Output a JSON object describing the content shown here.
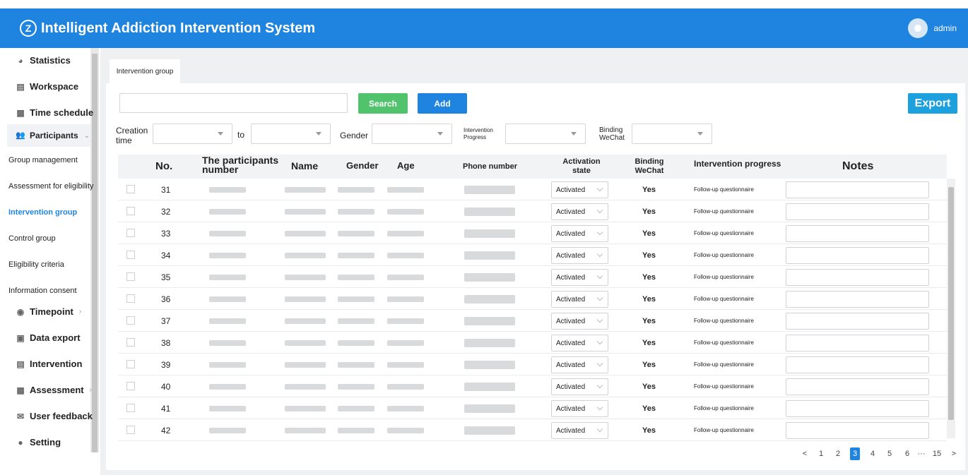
{
  "app": {
    "title": "Intelligent Addiction Intervention System",
    "user": "admin"
  },
  "sidebar": {
    "items": [
      {
        "label": "Statistics",
        "icon": "pie-chart-icon",
        "glyph": "◕"
      },
      {
        "label": "Workspace",
        "icon": "workspace-icon",
        "glyph": "▤"
      },
      {
        "label": "Time schedule",
        "icon": "calendar-icon",
        "glyph": "▦"
      },
      {
        "label": "Participants",
        "icon": "people-icon",
        "glyph": "👥"
      },
      {
        "label": "Timepoint",
        "icon": "timepoint-icon",
        "glyph": "◉"
      },
      {
        "label": "Data export",
        "icon": "export-folder-icon",
        "glyph": "▣"
      },
      {
        "label": "Intervention",
        "icon": "document-icon",
        "glyph": "▤"
      },
      {
        "label": "Assessment",
        "icon": "assessment-icon",
        "glyph": "▦"
      },
      {
        "label": "User feedback",
        "icon": "feedback-icon",
        "glyph": "✉"
      },
      {
        "label": "Setting",
        "icon": "setting-icon",
        "glyph": "●"
      }
    ],
    "subitems": [
      "Group management",
      "Assessment for eligibility",
      "Intervention group",
      "Control group",
      "Eligibility criteria",
      "Information consent"
    ],
    "active_subitem": "Intervention group"
  },
  "tab": {
    "label": "Intervention group"
  },
  "toolbar": {
    "search": "Search",
    "add": "Add",
    "export": "Export",
    "search_value": ""
  },
  "filters": {
    "creation_time_label": "Creation time",
    "to_label": "to",
    "gender_label": "Gender",
    "progress_label": "Intervention Progress",
    "wechat_label": "Binding WeChat"
  },
  "table": {
    "headers": {
      "no": "No.",
      "pnum": "The participants number",
      "name": "Name",
      "gender": "Gender",
      "age": "Age",
      "phone": "Phone number",
      "activation": "Activation state",
      "wechat": "Binding WeChat",
      "progress": "Intervention progress",
      "notes": "Notes"
    },
    "rows": [
      {
        "no": "31",
        "activation": "Activated",
        "wechat": "Yes",
        "progress": "Follow-up questionnaire"
      },
      {
        "no": "32",
        "activation": "Activated",
        "wechat": "Yes",
        "progress": "Follow-up questionnaire"
      },
      {
        "no": "33",
        "activation": "Activated",
        "wechat": "Yes",
        "progress": "Follow-up questionnaire"
      },
      {
        "no": "34",
        "activation": "Activated",
        "wechat": "Yes",
        "progress": "Follow-up questionnaire"
      },
      {
        "no": "35",
        "activation": "Activated",
        "wechat": "Yes",
        "progress": "Follow-up questionnaire"
      },
      {
        "no": "36",
        "activation": "Activated",
        "wechat": "Yes",
        "progress": "Follow-up questionnaire"
      },
      {
        "no": "37",
        "activation": "Activated",
        "wechat": "Yes",
        "progress": "Follow-up questionnaire"
      },
      {
        "no": "38",
        "activation": "Activated",
        "wechat": "Yes",
        "progress": "Follow-up questionnaire"
      },
      {
        "no": "39",
        "activation": "Activated",
        "wechat": "Yes",
        "progress": "Follow-up questionnaire"
      },
      {
        "no": "40",
        "activation": "Activated",
        "wechat": "Yes",
        "progress": "Follow-up questionnaire"
      },
      {
        "no": "41",
        "activation": "Activated",
        "wechat": "Yes",
        "progress": "Follow-up questionnaire"
      },
      {
        "no": "42",
        "activation": "Activated",
        "wechat": "Yes",
        "progress": "Follow-up questionnaire"
      }
    ]
  },
  "pagination": {
    "prev": "<",
    "next": ">",
    "pages": [
      "1",
      "2",
      "3",
      "4",
      "5",
      "6",
      "···",
      "15"
    ],
    "current": "3"
  },
  "colors": {
    "header": "#1e84e0",
    "search_button": "#52c36d",
    "add_button": "#1e84e0",
    "export_button": "#1ca0de",
    "active_text": "#1e84e0"
  }
}
